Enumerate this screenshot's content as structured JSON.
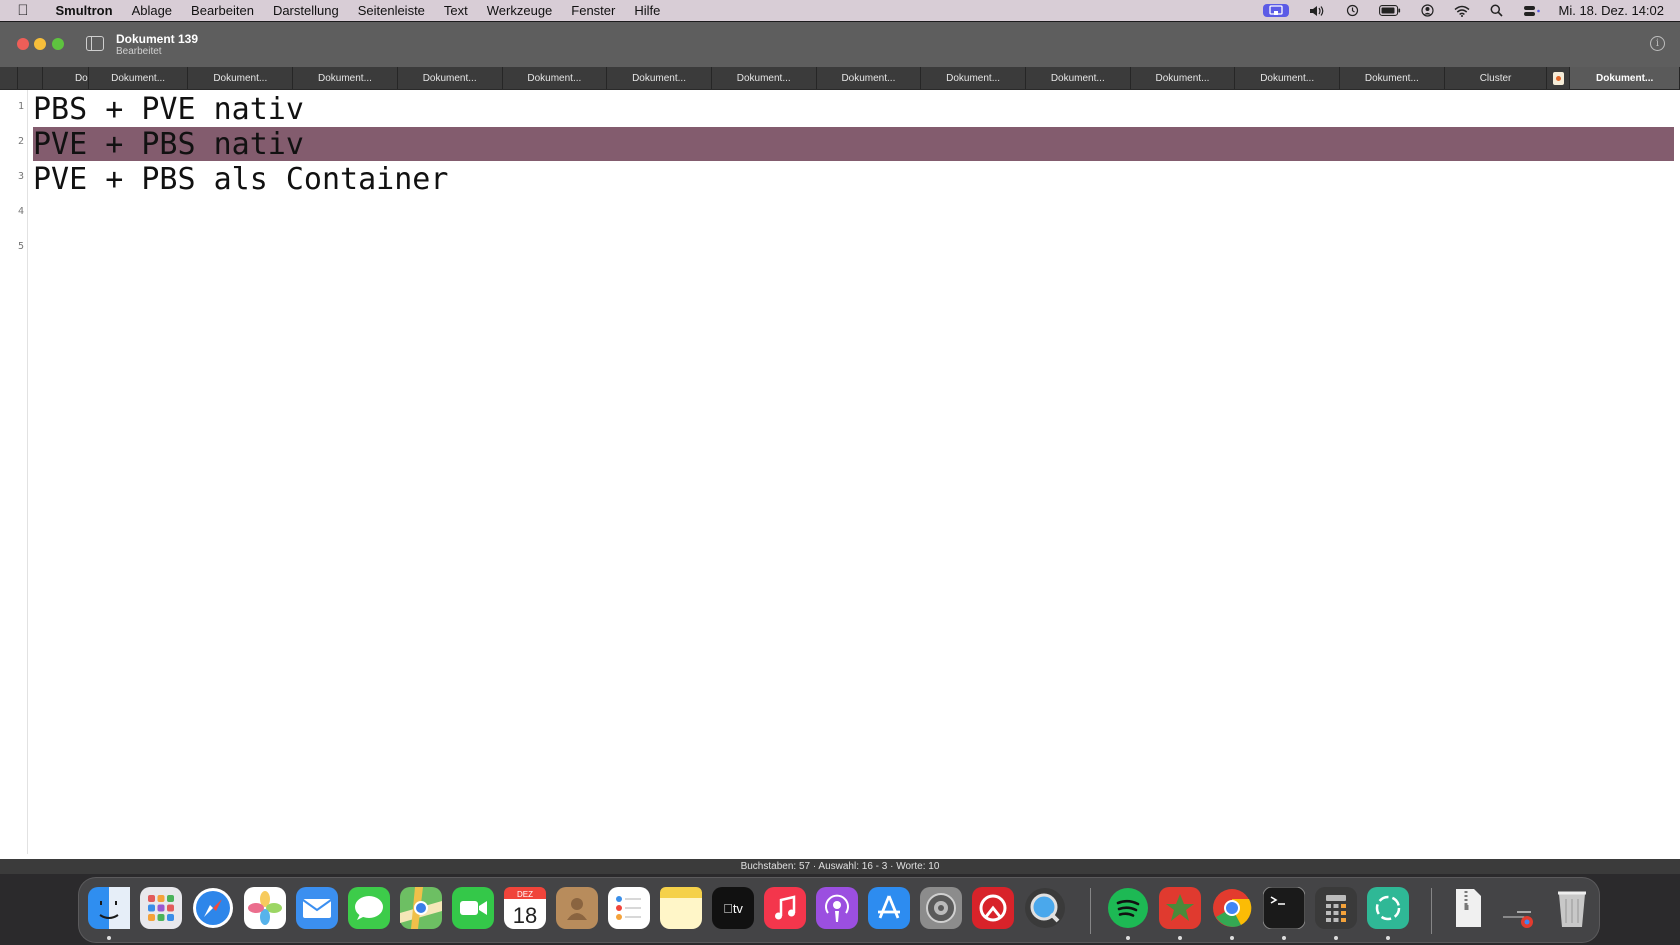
{
  "menubar": {
    "apple_icon": "apple-logo-icon",
    "app_name": "Smultron",
    "items": [
      "Ablage",
      "Bearbeiten",
      "Darstellung",
      "Seitenleiste",
      "Text",
      "Werkzeuge",
      "Fenster",
      "Hilfe"
    ],
    "status_icons": [
      "screen-mirroring-icon",
      "volume-icon",
      "time-machine-icon",
      "battery-icon",
      "user-icon",
      "wifi-icon",
      "spotlight-search-icon",
      "control-center-icon"
    ],
    "clock": "Mi. 18. Dez. 14:02"
  },
  "window": {
    "title": "Dokument 139",
    "subtitle": "Bearbeitet"
  },
  "tabs": [
    {
      "label": "",
      "active": false
    },
    {
      "label": "Do",
      "active": false
    },
    {
      "label": "Dokument...",
      "active": false
    },
    {
      "label": "Dokument...",
      "active": false
    },
    {
      "label": "Dokument...",
      "active": false
    },
    {
      "label": "Dokument...",
      "active": false
    },
    {
      "label": "Dokument...",
      "active": false
    },
    {
      "label": "Dokument...",
      "active": false
    },
    {
      "label": "Dokument...",
      "active": false
    },
    {
      "label": "Dokument...",
      "active": false
    },
    {
      "label": "Dokument...",
      "active": false
    },
    {
      "label": "Dokument...",
      "active": false
    },
    {
      "label": "Dokument...",
      "active": false
    },
    {
      "label": "Dokument...",
      "active": false
    },
    {
      "label": "Dokument...",
      "active": false
    },
    {
      "label": "Cluster",
      "active": false
    },
    {
      "label": "Dokument...",
      "active": true
    }
  ],
  "editor": {
    "lines": [
      {
        "number": "1",
        "text": "PBS + PVE nativ"
      },
      {
        "number": "2",
        "text": "PVE + PBS nativ"
      },
      {
        "number": "3",
        "text": "PVE + PBS als Container"
      },
      {
        "number": "4",
        "text": ""
      },
      {
        "number": "5",
        "text": ""
      }
    ],
    "selected_line": "2",
    "highlight_color": "#835c6e"
  },
  "statusbar": {
    "text": "Buchstaben: 57 · Auswahl: 16 - 3 · Worte: 10"
  },
  "calendar": {
    "month": "DEZ",
    "day": "18"
  },
  "dock": [
    {
      "name": "finder-icon",
      "color": "#2f8ef0"
    },
    {
      "name": "launchpad-icon",
      "color": "#e8e8ec"
    },
    {
      "name": "safari-icon",
      "color": "#2d86ea"
    },
    {
      "name": "photos-icon",
      "color": "#ffffff"
    },
    {
      "name": "mail-icon",
      "color": "#3b8ff0"
    },
    {
      "name": "messages-icon",
      "color": "#3dcc4a"
    },
    {
      "name": "maps-icon",
      "color": "#6dbf63"
    },
    {
      "name": "facetime-icon",
      "color": "#34c849"
    },
    {
      "name": "calendar-icon",
      "color": "#ffffff"
    },
    {
      "name": "contacts-icon",
      "color": "#b88c5c"
    },
    {
      "name": "reminders-icon",
      "color": "#ffffff"
    },
    {
      "name": "notes-icon",
      "color": "#fff6c8"
    },
    {
      "name": "apple-tv-icon",
      "color": "#111111"
    },
    {
      "name": "music-icon",
      "color": "#f4364c"
    },
    {
      "name": "podcasts-icon",
      "color": "#9b4fe0"
    },
    {
      "name": "app-store-icon",
      "color": "#2d8cf0"
    },
    {
      "name": "system-settings-icon",
      "color": "#8c8c8c"
    },
    {
      "name": "pdf-reader-icon",
      "color": "#d8232a"
    },
    {
      "name": "quicktime-icon",
      "color": "#3a3a3a"
    },
    {
      "name": "spotify-icon",
      "color": "#1db954"
    },
    {
      "name": "red-app-icon",
      "color": "#e03a2f"
    },
    {
      "name": "chrome-icon",
      "color": "#ffffff"
    },
    {
      "name": "terminal-icon",
      "color": "#1a1a1a"
    },
    {
      "name": "calculator-icon",
      "color": "#3a3a3a"
    },
    {
      "name": "chatgpt-icon",
      "color": "#2fb896"
    },
    {
      "name": "zip-archive-icon",
      "color": "#f0f0f0"
    },
    {
      "name": "downloads-stack-icon",
      "color": "#5a5a5a"
    },
    {
      "name": "trash-icon",
      "color": "#c8c8c8"
    }
  ]
}
